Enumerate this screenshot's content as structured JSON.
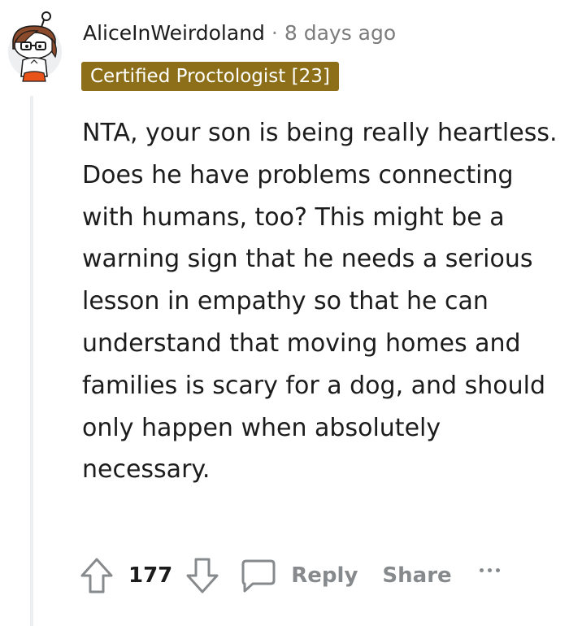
{
  "comment": {
    "author": "AliceInWeirdoland",
    "separator": "·",
    "time_ago": "8 days ago",
    "flair": "Certified Proctologist [23]",
    "body": "NTA, your son is being really heartless. Does he have problems connecting with humans, too? This might be a warning sign that he needs a serious lesson in empathy so that he can understand that moving homes and families is scary for a dog, and should only happen when absolutely necessary."
  },
  "actions": {
    "score": "177",
    "reply_label": "Reply",
    "share_label": "Share"
  },
  "icons": {
    "avatar": "snoo-avatar-glasses",
    "upvote": "arrow-up-outline-icon",
    "downvote": "arrow-down-outline-icon",
    "comment": "speech-bubble-icon",
    "more": "ellipsis-icon"
  },
  "colors": {
    "flair_background": "#8c6f18",
    "flair_text": "#ffffff",
    "muted": "#878a8c",
    "thread_line": "#eceeef"
  }
}
